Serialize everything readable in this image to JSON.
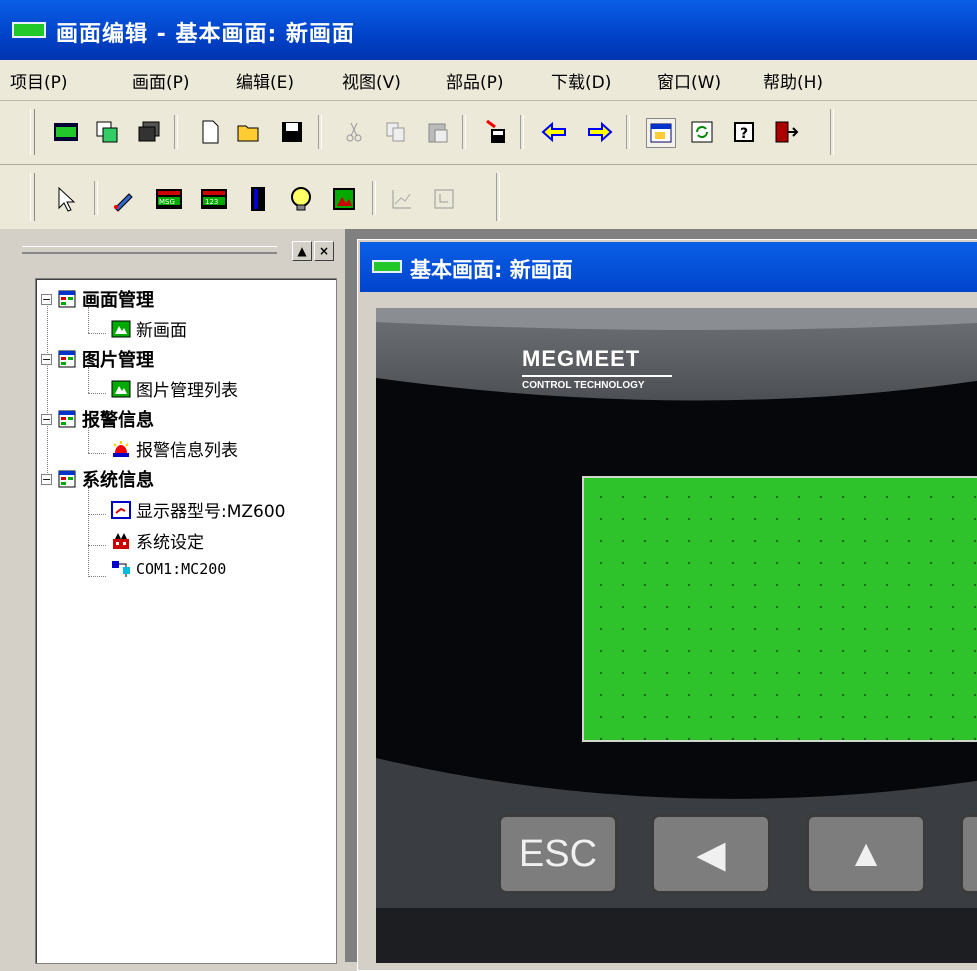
{
  "window": {
    "title": "画面编辑 - 基本画面: 新画面"
  },
  "menu": [
    "项目(P)",
    "画面(P)",
    "编辑(E)",
    "视图(V)",
    "部品(P)",
    "下载(D)",
    "窗口(W)",
    "帮助(H)"
  ],
  "toolbar1": [
    "screen-icon",
    "copy-screen-icon",
    "multi-screen-icon",
    "new-icon",
    "open-icon",
    "save-icon",
    "cut-icon",
    "copy-icon",
    "paste-icon",
    "download-icon",
    "back-icon",
    "forward-icon",
    "window-icon",
    "refresh-icon",
    "help-icon",
    "exit-icon"
  ],
  "toolbar2": [
    "select-icon",
    "pen-icon",
    "message-display-icon",
    "numeric-display-icon",
    "bar-graph-icon",
    "lamp-icon",
    "picture-icon",
    "trend-icon",
    "alarm-icon"
  ],
  "panel": {
    "btn_up": "▲",
    "btn_close": "×"
  },
  "tree": [
    {
      "label": "画面管理",
      "bold": true,
      "icon": "folder-icon",
      "children": [
        {
          "label": "新画面",
          "icon": "screen-item-icon"
        }
      ]
    },
    {
      "label": "图片管理",
      "bold": true,
      "icon": "folder-icon",
      "children": [
        {
          "label": "图片管理列表",
          "icon": "picture-list-icon"
        }
      ]
    },
    {
      "label": "报警信息",
      "bold": true,
      "icon": "folder-icon",
      "children": [
        {
          "label": "报警信息列表",
          "icon": "alarm-list-icon"
        }
      ]
    },
    {
      "label": "系统信息",
      "bold": true,
      "icon": "folder-icon",
      "children": [
        {
          "label": "显示器型号:MZ600",
          "icon": "display-model-icon"
        },
        {
          "label": "系统设定",
          "icon": "system-setting-icon"
        },
        {
          "label": "COM1:MC200",
          "icon": "com-port-icon"
        }
      ]
    }
  ],
  "child_window": {
    "title": "基本画面: 新画面"
  },
  "device": {
    "brand": "MEGMEET",
    "brand_sub": "CONTROL TECHNOLOGY",
    "keys": [
      "ESC",
      "◀",
      "▲",
      ""
    ]
  },
  "colors": {
    "titlebar": "#0a5fe6",
    "lcd": "#2ec32a",
    "panel_bg": "#d4d0c8"
  }
}
